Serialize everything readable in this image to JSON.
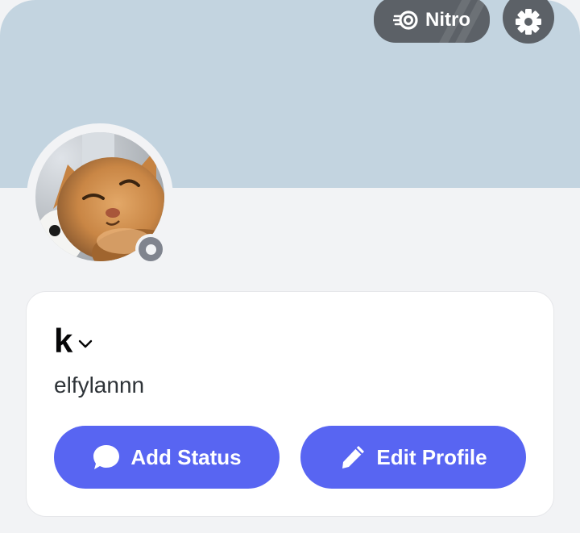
{
  "header": {
    "nitro_label": "Nitro",
    "nitro_icon": "nitro-icon",
    "settings_icon": "gear-icon"
  },
  "profile": {
    "display_name": "k",
    "username": "elfylannn",
    "status": "offline"
  },
  "actions": {
    "add_status_label": "Add Status",
    "edit_profile_label": "Edit Profile"
  },
  "colors": {
    "banner": "#c3d4e0",
    "background": "#f2f3f5",
    "blurple": "#5865f2",
    "chip": "#5c6167",
    "status_offline": "#80848e"
  }
}
